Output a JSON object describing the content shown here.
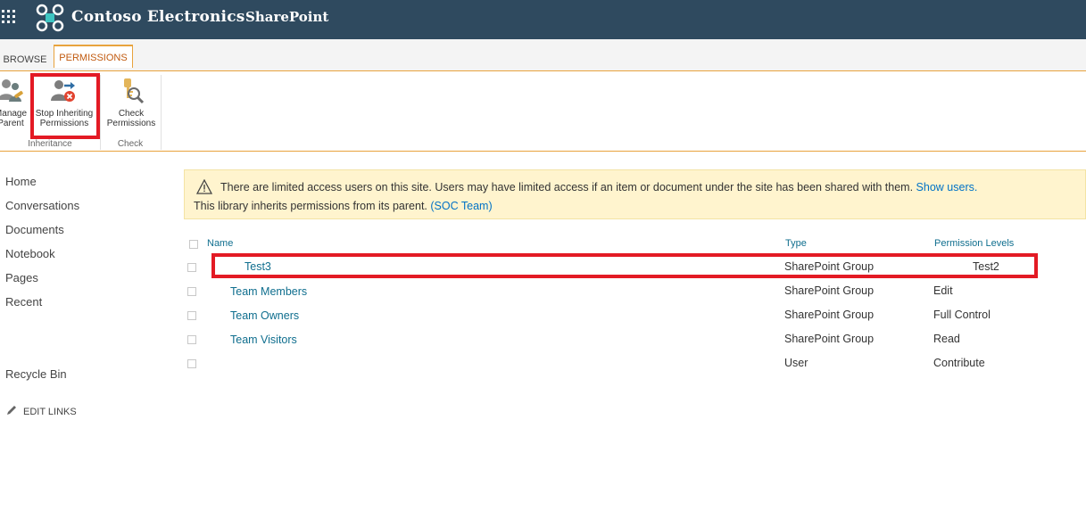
{
  "suitebar": {
    "brand": "Contoso Electronics",
    "app": "SharePoint"
  },
  "ribbon": {
    "tabs": [
      "BROWSE",
      "PERMISSIONS"
    ],
    "buttons": {
      "manage_parent": [
        "Manage",
        "Parent"
      ],
      "stop_inheriting": [
        "Stop Inheriting",
        "Permissions"
      ],
      "check_permissions": [
        "Check",
        "Permissions"
      ]
    },
    "groups": [
      "Inheritance",
      "Check"
    ]
  },
  "nav": {
    "items": [
      "Home",
      "Conversations",
      "Documents",
      "Notebook",
      "Pages",
      "Recent",
      "Recycle Bin"
    ],
    "edit_links": "EDIT LINKS"
  },
  "message": {
    "line1_text": "There are limited access users on this site. Users may have limited access if an item or document under the site has been shared with them.",
    "line1_link": "Show users.",
    "line2_text": "This library inherits permissions from its parent.",
    "line2_link": "(SOC Team)"
  },
  "list": {
    "headers": {
      "name": "Name",
      "type": "Type",
      "levels": "Permission Levels"
    },
    "rows": [
      {
        "name": "Test3",
        "type": "SharePoint Group",
        "level": "Test2"
      },
      {
        "name": "Team Members",
        "type": "SharePoint Group",
        "level": "Edit"
      },
      {
        "name": "Team Owners",
        "type": "SharePoint Group",
        "level": "Full Control"
      },
      {
        "name": "Team Visitors",
        "type": "SharePoint Group",
        "level": "Read"
      },
      {
        "name": "",
        "type": "User",
        "level": "Contribute"
      }
    ]
  },
  "colors": {
    "suitebar": "#2f4a5f",
    "accent_orange": "#e8a33d",
    "highlight_red": "#e31a24",
    "link_teal": "#0f6e8e",
    "link_blue": "#0072c6",
    "message_bg": "#fff4ce"
  }
}
